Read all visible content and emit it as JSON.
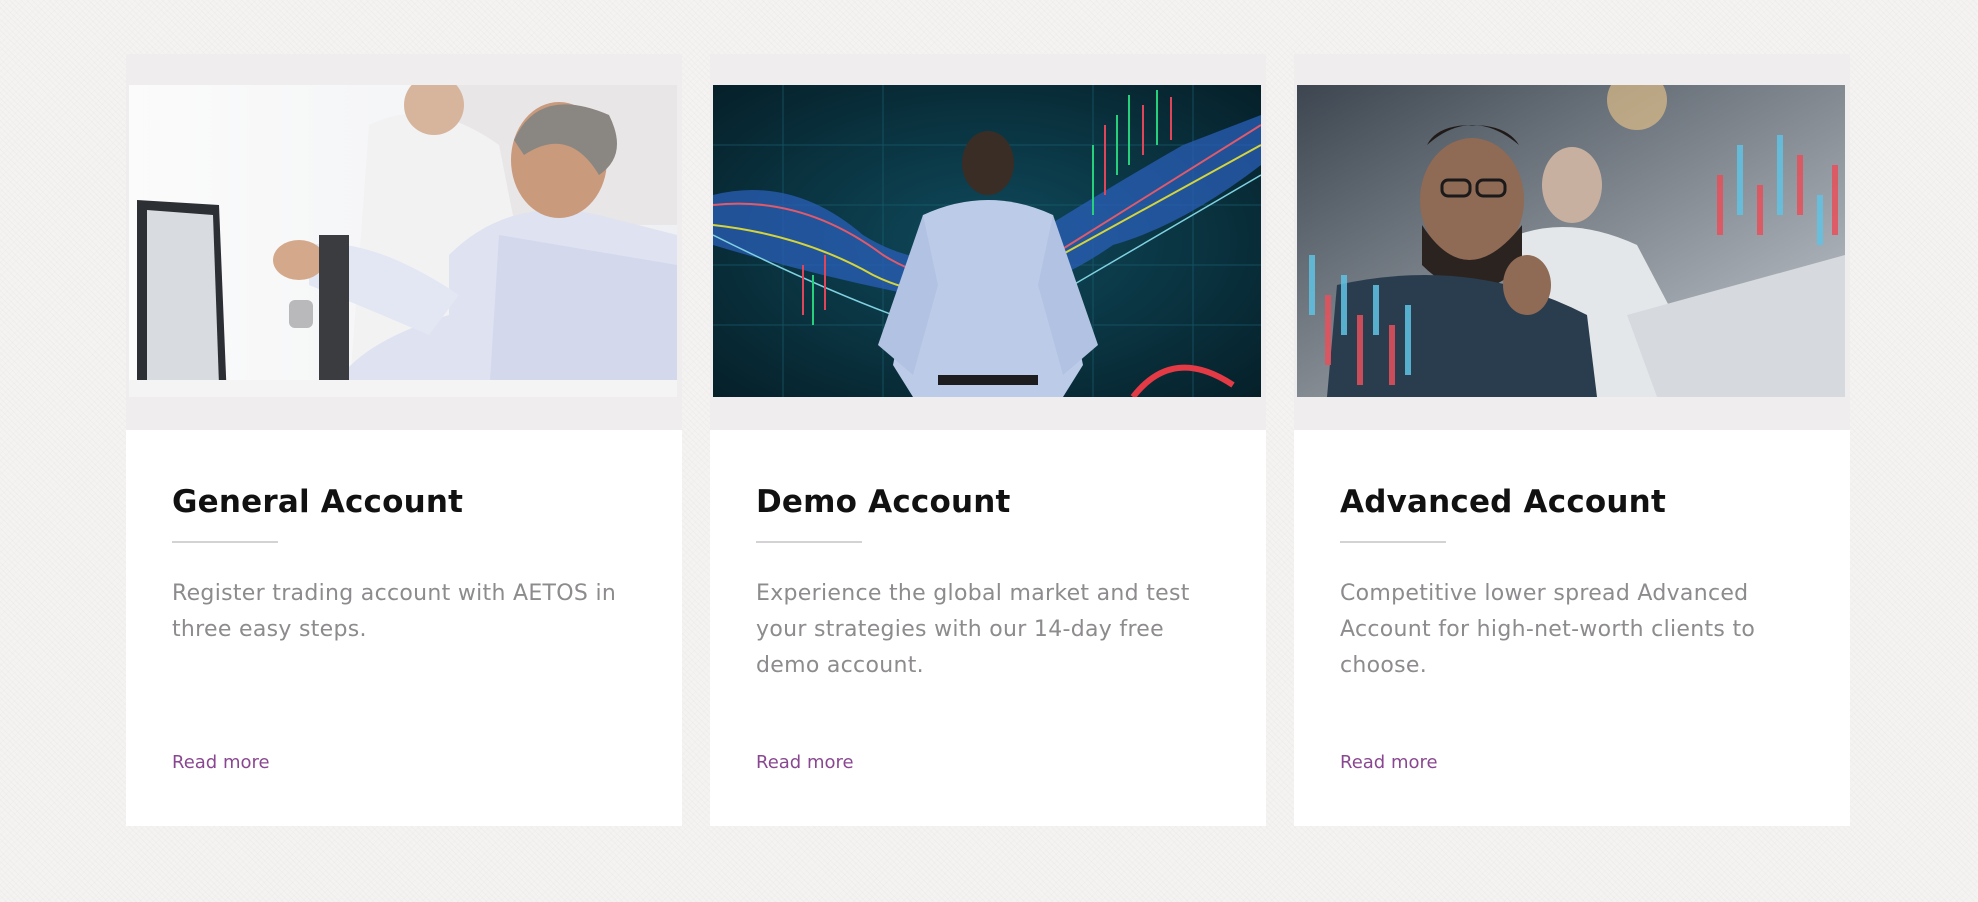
{
  "theme": {
    "link_color": "#8a4791",
    "title_color": "#111111",
    "text_color": "#8d8b8d"
  },
  "cards": [
    {
      "image_alt": "trader-at-monitor-photo",
      "title": "General Account",
      "description": "Register trading account with AETOS in three easy steps.",
      "link_label": "Read more"
    },
    {
      "image_alt": "man-facing-market-charts-photo",
      "title": "Demo Account",
      "description": "Experience the global market and test your strategies with our 14-day free demo account.",
      "link_label": "Read more"
    },
    {
      "image_alt": "analysts-with-candlestick-overlay-photo",
      "title": "Advanced Account",
      "description": "Competitive lower spread Advanced Account for high-net-worth clients to choose.",
      "link_label": "Read more"
    }
  ]
}
